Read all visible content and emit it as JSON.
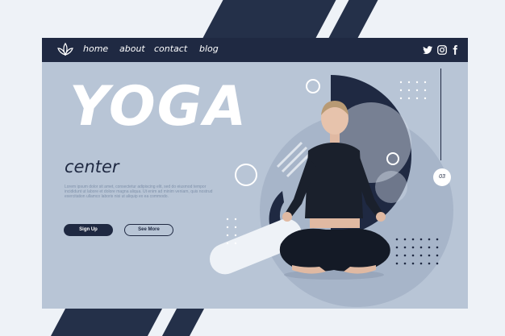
{
  "nav": {
    "links": [
      "home",
      "about",
      "contact",
      "blog"
    ],
    "social": [
      "twitter-icon",
      "instagram-icon",
      "facebook-icon"
    ]
  },
  "hero": {
    "title": "YOGA",
    "subtitle": "center",
    "body_text": "Lorem ipsum dolor sit amet, consectetur adipiscing elit, sed do eiusmod tempor incididunt ut labore et dolore magna aliqua. Ut enim ad minim veniam, quis nostrud exercitation ullamco laboris nisi ut aliquip ex ea commodo.",
    "primary_button": "Sign Up",
    "secondary_button": "See More"
  },
  "slider": {
    "page_indicator": "03"
  },
  "colors": {
    "navy": "#1f2942",
    "panel": "#b8c5d6",
    "background": "#eef2f7"
  }
}
